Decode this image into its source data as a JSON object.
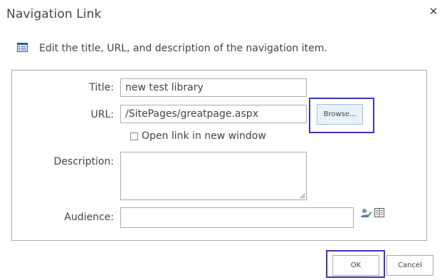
{
  "dialog": {
    "title": "Navigation Link",
    "close_glyph": "✕",
    "close_icon": "close-icon"
  },
  "instruction": {
    "icon": "list-page-icon",
    "text": "Edit the title, URL, and description of the navigation item."
  },
  "form": {
    "title": {
      "label": "Title:",
      "value": "new test library"
    },
    "url": {
      "label": "URL:",
      "value": "/SitePages/greatpage.aspx"
    },
    "browse_label": "Browse...",
    "open_new_window": {
      "label": "Open link in new window",
      "checked": false
    },
    "description": {
      "label": "Description:",
      "value": ""
    },
    "audience": {
      "label": "Audience:",
      "value": "",
      "check_names_icon": "people-picker-check-icon",
      "browse_icon": "address-book-icon"
    }
  },
  "buttons": {
    "ok": "OK",
    "cancel": "Cancel"
  },
  "colors": {
    "text": "#444444",
    "border": "#ababab",
    "highlight_box": "#3a37b8",
    "browse_button_bg": "#e6f2fa",
    "browse_button_border": "#9fc3de"
  }
}
